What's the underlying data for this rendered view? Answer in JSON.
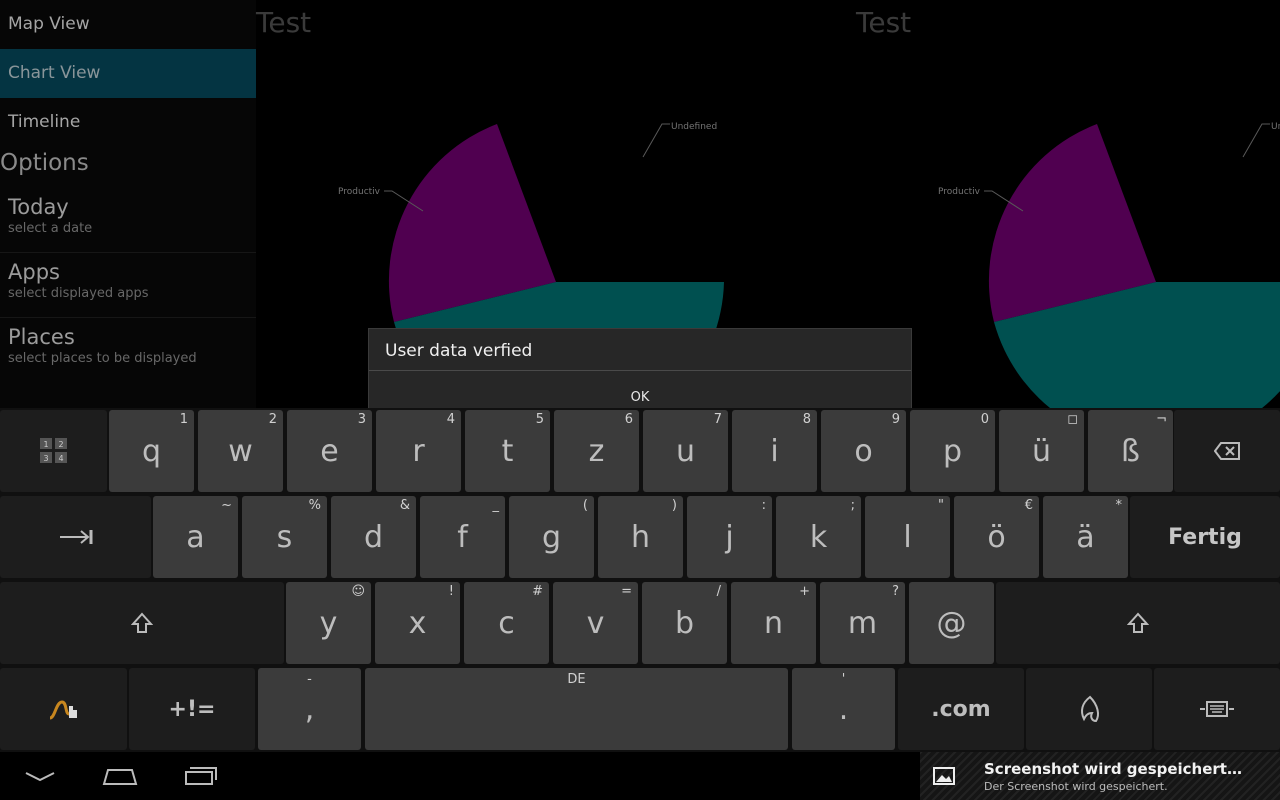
{
  "sidebar": {
    "nav": [
      {
        "label": "Map View"
      },
      {
        "label": "Chart View"
      },
      {
        "label": "Timeline"
      }
    ],
    "section_title": "Options",
    "options": [
      {
        "title": "Today",
        "subtitle": "select a date"
      },
      {
        "title": "Apps",
        "subtitle": "select displayed apps"
      },
      {
        "title": "Places",
        "subtitle": "select places to be displayed"
      }
    ]
  },
  "panels": [
    {
      "title": "Test"
    },
    {
      "title": "Test"
    }
  ],
  "chart_data": [
    {
      "type": "pie",
      "title": "Test",
      "labels": [
        "Undefined",
        "Productiv",
        ""
      ],
      "colors": [
        "#000000",
        "#6b006b",
        "#006b6b"
      ]
    },
    {
      "type": "pie",
      "title": "Test",
      "labels": [
        "Undefined",
        "Productiv",
        ""
      ],
      "colors": [
        "#000000",
        "#6b006b",
        "#006b6b"
      ]
    }
  ],
  "dialog": {
    "title": "User data verfied",
    "ok_label": "OK"
  },
  "keyboard": {
    "row1": [
      {
        "label": "q",
        "hint": "1"
      },
      {
        "label": "w",
        "hint": "2"
      },
      {
        "label": "e",
        "hint": "3"
      },
      {
        "label": "r",
        "hint": "4"
      },
      {
        "label": "t",
        "hint": "5"
      },
      {
        "label": "z",
        "hint": "6"
      },
      {
        "label": "u",
        "hint": "7"
      },
      {
        "label": "i",
        "hint": "8"
      },
      {
        "label": "o",
        "hint": "9"
      },
      {
        "label": "p",
        "hint": "0"
      },
      {
        "label": "ü",
        "hint": "◻"
      },
      {
        "label": "ß",
        "hint": "¬"
      }
    ],
    "row2": [
      {
        "label": "a",
        "hint": "~"
      },
      {
        "label": "s",
        "hint": "%"
      },
      {
        "label": "d",
        "hint": "&"
      },
      {
        "label": "f",
        "hint": "_"
      },
      {
        "label": "g",
        "hint": "("
      },
      {
        "label": "h",
        "hint": ")"
      },
      {
        "label": "j",
        "hint": ":"
      },
      {
        "label": "k",
        "hint": ";"
      },
      {
        "label": "l",
        "hint": "\""
      },
      {
        "label": "ö",
        "hint": "€"
      },
      {
        "label": "ä",
        "hint": "*"
      }
    ],
    "done_label": "Fertig",
    "row3": [
      {
        "label": "y",
        "hint": "☺"
      },
      {
        "label": "x",
        "hint": "!"
      },
      {
        "label": "c",
        "hint": "#"
      },
      {
        "label": "v",
        "hint": "="
      },
      {
        "label": "b",
        "hint": "/"
      },
      {
        "label": "n",
        "hint": "+"
      },
      {
        "label": "m",
        "hint": "?"
      },
      {
        "label": "@",
        "hint": ""
      }
    ],
    "symbols_label": "+!=",
    "comma": {
      "label": ",",
      "hint": "-"
    },
    "space_hint": "DE",
    "period": {
      "label": ".",
      "hint": "'"
    },
    "dotcom_label": ".com"
  },
  "notification": {
    "title": "Screenshot wird gespeichert…",
    "subtitle": "Der Screenshot wird gespeichert."
  }
}
